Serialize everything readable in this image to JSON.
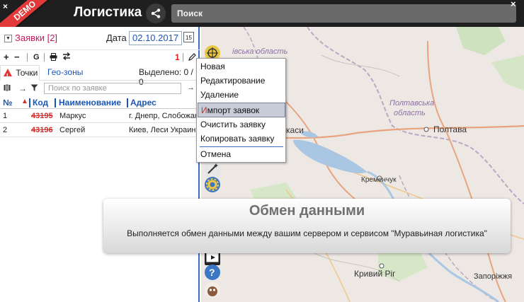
{
  "header": {
    "demo_badge": "DEMO",
    "close_glyph": "×",
    "title": "Логистика",
    "search_placeholder": "Поиск",
    "top_close_glyph": "×"
  },
  "orders_panel": {
    "orders_label": "Заявки [2]",
    "date_label": "Дата",
    "date_value": "02.10.2017",
    "calendar_day": "15",
    "toolbar": {
      "add": "+",
      "remove": "−",
      "g_label": "G",
      "error_count": "1"
    },
    "tabs": {
      "points": "Точки",
      "geozones": "Гео-зоны"
    },
    "selected_label": "Выделено: 0 / 0",
    "filter_placeholder": "Поиск по заявке",
    "columns": [
      "№",
      "Код",
      "Наименование",
      "Адрес"
    ],
    "rows": [
      {
        "num": "1",
        "code": "43195",
        "name": "Маркус",
        "address": "г. Днепр, Слобожанский"
      },
      {
        "num": "2",
        "code": "43196",
        "name": "Сергей",
        "address": "Киев, Леси Украинки"
      }
    ]
  },
  "dropdown_menu": {
    "items": [
      "Новая",
      "Редактирование",
      "Удаление",
      "Импорт заявок",
      "Очистить заявку",
      "Копировать заявку",
      "Отмена"
    ],
    "active_index": 3
  },
  "map": {
    "labels": {
      "region_top": "івська область",
      "poltava_region_1": "Полтавська",
      "poltava_region_2": "область",
      "poltava": "Полтава",
      "cherkasy": "каси",
      "kremenchuk": "Кременчук",
      "kryvyi_rih": "Кривий Ріг",
      "zaporizhzhia": "Запоріжжя"
    }
  },
  "modal": {
    "title": "Обмен данными",
    "message": "Выполняется обмен данными между вашим сервером и сервисом \"Муравьиная логистика\""
  },
  "colors": {
    "topbar": "#1f1f1f",
    "accent_blue": "#1a56b8",
    "demo_red": "#e23a3a",
    "error_red": "#d32f2f",
    "lake": "#a9c6e2"
  }
}
